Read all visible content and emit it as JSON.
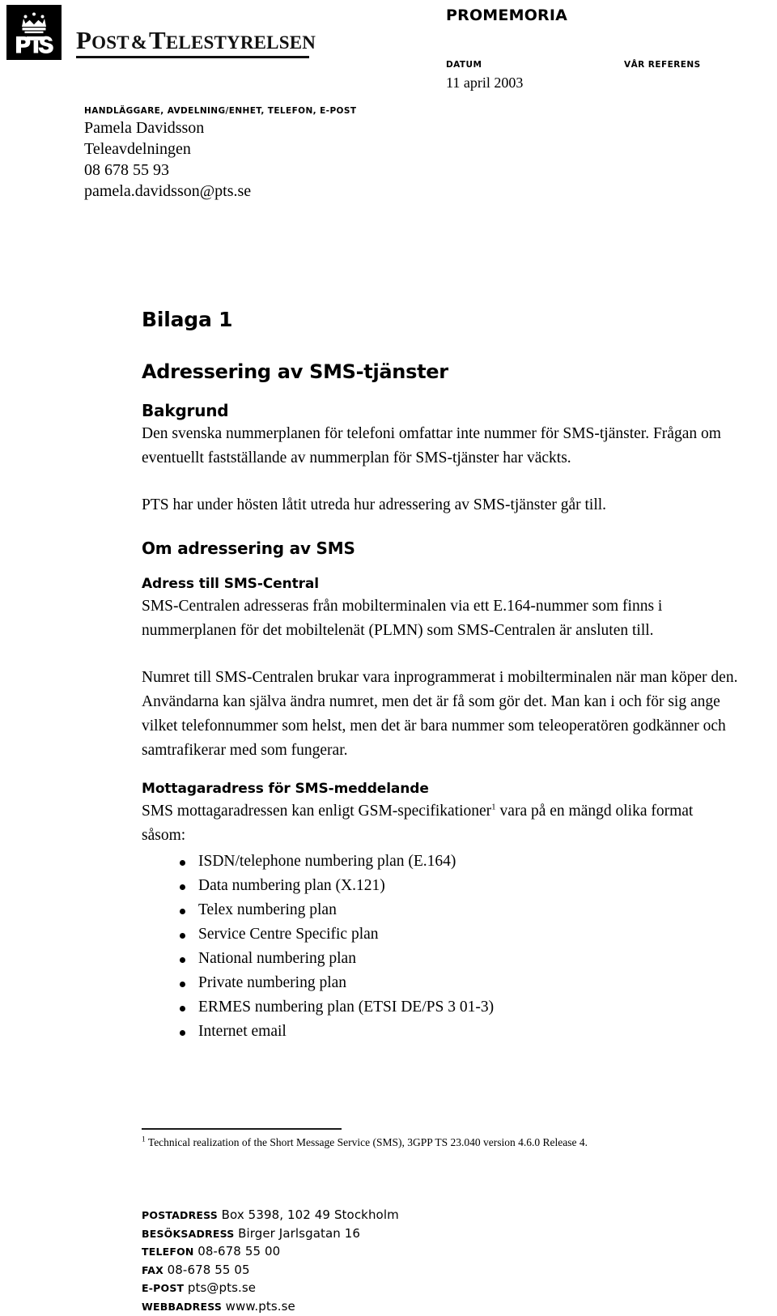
{
  "logo": {
    "mark_alt": "PTS crown emblem",
    "wordmark_part1": "P",
    "wordmark_part1_rest": "OST",
    "wordmark_amp": "&",
    "wordmark_part2": "T",
    "wordmark_part2_rest": "ELESTYRELSEN"
  },
  "header": {
    "doc_type": "PROMEMORIA",
    "datum_label": "DATUM",
    "datum_value": "11 april 2003",
    "reference_label": "VÅR REFERENS",
    "reference_value": ""
  },
  "handler": {
    "label": "HANDLÄGGARE, AVDELNING/ENHET, TELEFON, E-POST",
    "name": "Pamela Davidsson",
    "department": "Teleavdelningen",
    "phone": "08 678 55 93",
    "email": "pamela.davidsson@pts.se"
  },
  "document": {
    "appendix_title": "Bilaga 1",
    "title": "Adressering av SMS-tjänster",
    "sections": {
      "bakgrund_heading": "Bakgrund",
      "bakgrund_p1": "Den svenska nummerplanen för telefoni omfattar inte nummer för SMS-tjänster. Frågan om eventuellt fastställande av nummerplan för SMS-tjänster har väckts.",
      "bakgrund_p2": "PTS har under hösten låtit utreda hur adressering av SMS-tjänster går till.",
      "om_adressering_heading": "Om adressering av SMS",
      "adress_central_heading": "Adress till SMS-Central",
      "adress_central_p1": "SMS-Centralen adresseras från mobilterminalen via ett E.164-nummer som finns i nummerplanen för det mobiltelenät (PLMN) som SMS-Centralen är ansluten till.",
      "adress_central_p2": "Numret till SMS-Centralen brukar vara inprogrammerat i mobilterminalen när man köper den. Användarna kan själva ändra numret, men det är få som gör det. Man kan i och för sig ange vilket telefonnummer som helst, men det är bara nummer som teleoperatören godkänner och samtrafikerar med som fungerar.",
      "mottagaradress_heading": "Mottagaradress för SMS-meddelande",
      "mottagaradress_p1_before": "SMS mottagaradressen kan enligt GSM-specifikationer",
      "mottagaradress_footnote_marker": "1",
      "mottagaradress_p1_after": " vara på en mängd olika format såsom:"
    },
    "plan_list": [
      "ISDN/telephone numbering plan (E.164)",
      "Data numbering plan (X.121)",
      "Telex numbering plan",
      "Service Centre Specific plan",
      "National numbering plan",
      "Private numbering plan",
      "ERMES numbering plan (ETSI DE/PS 3 01-3)",
      "Internet email"
    ],
    "footnote": {
      "marker": "1",
      "text": "Technical realization of the Short Message Service (SMS), 3GPP TS 23.040 version 4.6.0 Release 4."
    }
  },
  "footer": {
    "rows": [
      {
        "label": "POSTADRESS",
        "value": "Box 5398, 102 49 Stockholm"
      },
      {
        "label": "BESÖKSADRESS",
        "value": "Birger Jarlsgatan 16"
      },
      {
        "label": "TELEFON",
        "value": "08-678 55 00"
      },
      {
        "label": "FAX",
        "value": "08-678 55 05"
      },
      {
        "label": "E-POST",
        "value": "pts@pts.se"
      },
      {
        "label": "WEBBADRESS",
        "value": "www.pts.se"
      }
    ]
  },
  "colors": {
    "ink": "#000000",
    "logo_background": "#000000",
    "logo_foreground": "#ffffff",
    "paper": "#ffffff"
  }
}
